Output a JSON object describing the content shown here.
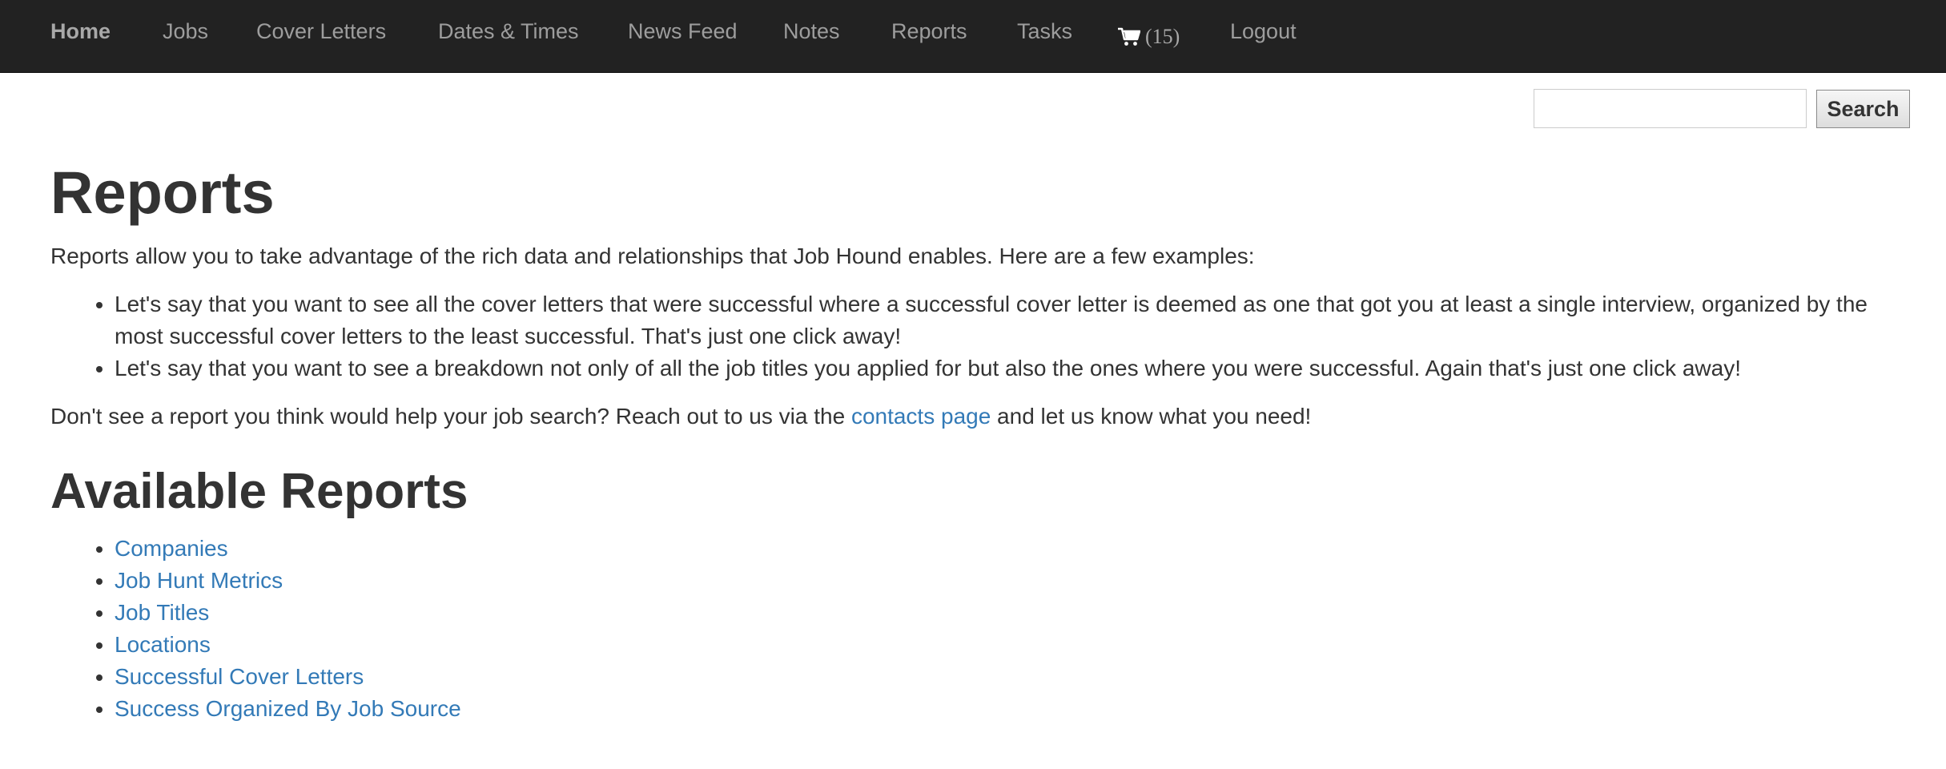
{
  "nav": {
    "home": "Home",
    "jobs": "Jobs",
    "cover_letters": "Cover Letters",
    "dates_times": "Dates & Times",
    "news_feed": "News Feed",
    "notes": "Notes",
    "reports": "Reports",
    "tasks": "Tasks",
    "cart_count": "(15)",
    "logout": "Logout"
  },
  "search": {
    "value": "",
    "button_label": "Search"
  },
  "page": {
    "title": "Reports",
    "intro": "Reports allow you to take advantage of the rich data and relationships that Job Hound enables. Here are a few examples:",
    "examples": [
      "Let's say that you want to see all the cover letters that were successful where a successful cover letter is deemed as one that got you at least a single interview, organized by the most successful cover letters to the least successful. That's just one click away!",
      "Let's say that you want to see a breakdown not only of all the job titles you applied for but also the ones where you were successful. Again that's just one click away!"
    ],
    "closing_before": "Don't see a report you think would help your job search? Reach out to us via the ",
    "closing_link": "contacts page",
    "closing_after": " and let us know what you need!",
    "available_title": "Available Reports",
    "reports": [
      "Companies",
      "Job Hunt Metrics",
      "Job Titles",
      "Locations",
      "Successful Cover Letters",
      "Success Organized By Job Source"
    ]
  },
  "colors": {
    "navbar_bg": "#222222",
    "nav_text": "#9d9d9d",
    "link": "#337ab7",
    "text": "#333333"
  },
  "icons": {
    "cart": "shopping-cart-icon"
  }
}
